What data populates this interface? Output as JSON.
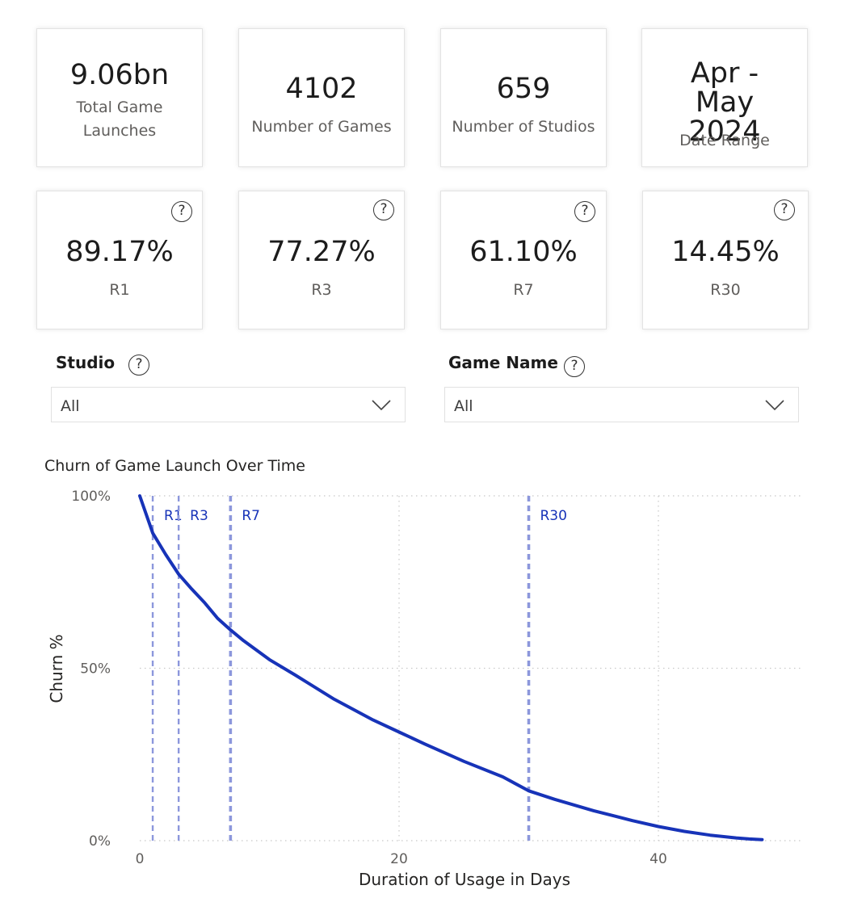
{
  "kpi_cards": [
    {
      "value": "9.06bn",
      "label": "Total Game Launches"
    },
    {
      "value": "4102",
      "label": "Number of Games"
    },
    {
      "value": "659",
      "label": "Number of Studios"
    },
    {
      "value": "Apr - May 2024",
      "label": "Date Range"
    }
  ],
  "retention_cards": [
    {
      "value": "89.17%",
      "label": "R1",
      "help": "?"
    },
    {
      "value": "77.27%",
      "label": "R3",
      "help": "?"
    },
    {
      "value": "61.10%",
      "label": "R7",
      "help": "?"
    },
    {
      "value": "14.45%",
      "label": "R30",
      "help": "?"
    }
  ],
  "filters": {
    "studio": {
      "title": "Studio",
      "value": "All",
      "help": "?"
    },
    "game_name": {
      "title": "Game Name",
      "value": "All",
      "help": "?"
    }
  },
  "colors": {
    "line": "#1733b8",
    "reference_lines": "#8c97dc",
    "grid": "#c8c8c8"
  },
  "chart_data": {
    "type": "line",
    "title": "Churn of Game Launch Over Time",
    "xlabel": "Duration of Usage in Days",
    "ylabel": "Churn %",
    "xlim": [
      0,
      51
    ],
    "ylim": [
      0,
      100
    ],
    "x_ticks": [
      0,
      20,
      40
    ],
    "x_tick_labels": [
      "0",
      "20",
      "40"
    ],
    "y_ticks": [
      0,
      50,
      100
    ],
    "y_tick_labels": [
      "0%",
      "50%",
      "100%"
    ],
    "grid": true,
    "series": [
      {
        "x": [
          0,
          1,
          2,
          3,
          4,
          5,
          6,
          7,
          8,
          10,
          12,
          15,
          18,
          20,
          22,
          25,
          28,
          30,
          32,
          35,
          38,
          40,
          42,
          44,
          46,
          47,
          48
        ],
        "y": [
          100,
          89.17,
          83,
          77.27,
          73,
          69,
          64.5,
          61.1,
          58,
          52.5,
          48,
          41,
          35,
          31.5,
          28,
          23,
          18.5,
          14.45,
          12,
          8.7,
          5.8,
          4.1,
          2.7,
          1.6,
          0.8,
          0.5,
          0.3
        ]
      }
    ],
    "reference_lines": [
      {
        "x": 1,
        "label": "R1"
      },
      {
        "x": 3,
        "label": "R3"
      },
      {
        "x": 7,
        "label": "R7"
      },
      {
        "x": 30,
        "label": "R30"
      }
    ]
  }
}
